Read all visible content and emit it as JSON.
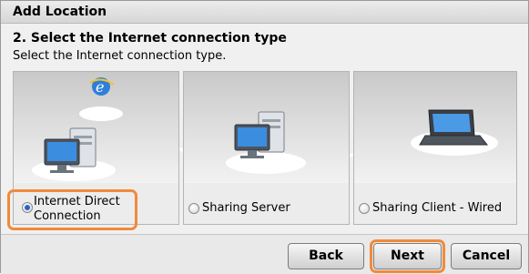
{
  "window": {
    "title": "Add Location"
  },
  "step": {
    "title": "2. Select the Internet connection type",
    "description": "Select the Internet connection type."
  },
  "options": [
    {
      "label_line1": "Internet Direct",
      "label_line2": "Connection",
      "selected": true,
      "icon": "computer-with-internet-icon"
    },
    {
      "label": "Sharing Server",
      "selected": false,
      "icon": "server-computer-icon"
    },
    {
      "label": "Sharing Client - Wired",
      "selected": false,
      "icon": "laptop-icon"
    }
  ],
  "buttons": {
    "back": "Back",
    "next": "Next",
    "cancel": "Cancel"
  },
  "colors": {
    "highlight": "#f08a3c",
    "accent": "#2a63c9"
  }
}
